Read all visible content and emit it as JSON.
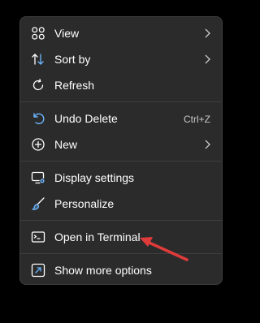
{
  "context_menu": {
    "items": [
      {
        "label": "View",
        "icon": "grid-icon",
        "has_submenu": true
      },
      {
        "label": "Sort by",
        "icon": "sort-icon",
        "has_submenu": true
      },
      {
        "label": "Refresh",
        "icon": "refresh-icon",
        "has_submenu": false
      },
      {
        "label": "Undo Delete",
        "icon": "undo-icon",
        "shortcut": "Ctrl+Z"
      },
      {
        "label": "New",
        "icon": "new-plus-icon",
        "has_submenu": true
      },
      {
        "label": "Display settings",
        "icon": "display-settings-icon"
      },
      {
        "label": "Personalize",
        "icon": "brush-icon"
      },
      {
        "label": "Open in Terminal",
        "icon": "terminal-icon"
      },
      {
        "label": "Show more options",
        "icon": "show-more-icon"
      }
    ]
  },
  "annotation": {
    "arrow_color": "#e03b3b"
  },
  "colors": {
    "menu_background": "#2b2b2b",
    "accent_blue": "#6cb6ff",
    "text": "#ffffff"
  }
}
